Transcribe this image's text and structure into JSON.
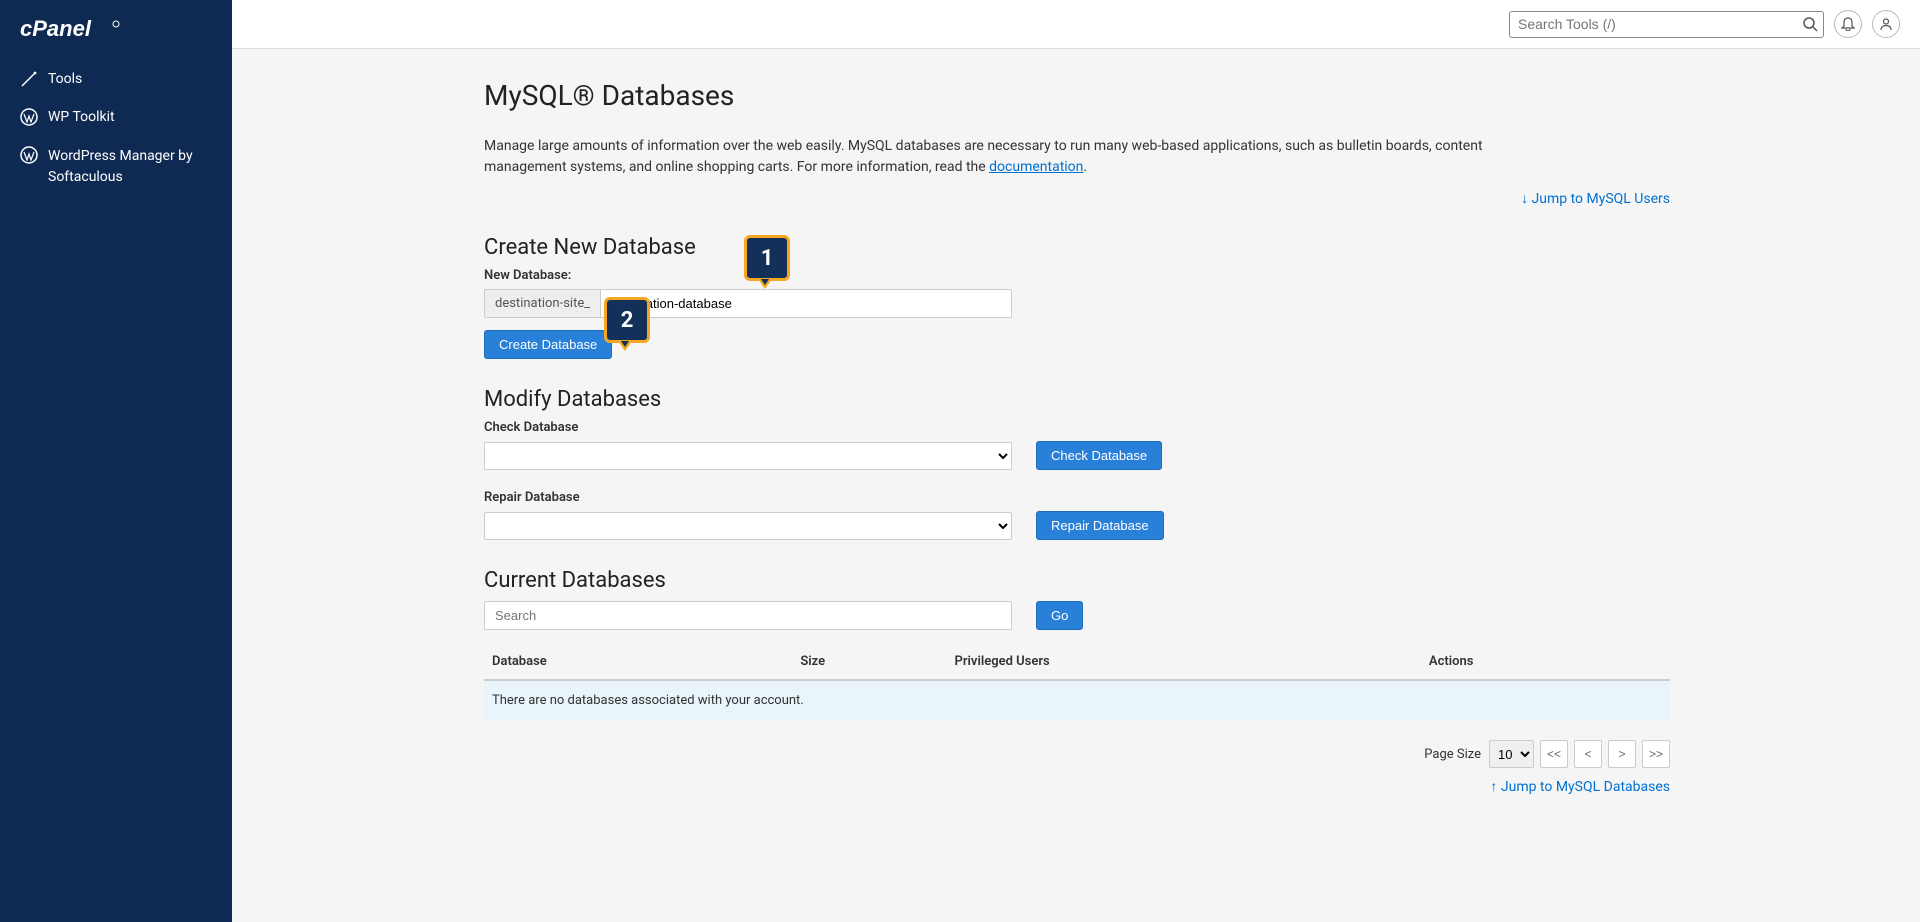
{
  "sidebar": {
    "items": [
      {
        "label": "Tools",
        "icon": "tools-icon"
      },
      {
        "label": "WP Toolkit",
        "icon": "wordpress-icon"
      },
      {
        "label": "WordPress Manager by Softaculous",
        "icon": "wordpress-icon"
      }
    ]
  },
  "topbar": {
    "search_placeholder": "Search Tools (/)"
  },
  "page": {
    "title": "MySQL® Databases",
    "intro_text": "Manage large amounts of information over the web easily. MySQL databases are necessary to run many web-based applications, such as bulletin boards, content management systems, and online shopping carts. For more information, read the ",
    "doc_link": "documentation",
    "intro_suffix": ".",
    "jump_users": "↓ Jump to MySQL Users",
    "jump_databases": "↑ Jump to MySQL Databases"
  },
  "create": {
    "heading": "Create New Database",
    "label": "New Database:",
    "prefix": "destination-site_",
    "value": "destination-database",
    "button": "Create Database"
  },
  "modify": {
    "heading": "Modify Databases",
    "check_label": "Check Database",
    "check_button": "Check Database",
    "repair_label": "Repair Database",
    "repair_button": "Repair Database"
  },
  "current": {
    "heading": "Current Databases",
    "search_placeholder": "Search",
    "go": "Go",
    "cols": {
      "db": "Database",
      "size": "Size",
      "users": "Privileged Users",
      "actions": "Actions"
    },
    "empty": "There are no databases associated with your account."
  },
  "pager": {
    "label": "Page Size",
    "size": "10",
    "first": "<<",
    "prev": "<",
    "next": ">",
    "last": ">>"
  },
  "callouts": {
    "1": "1",
    "2": "2"
  }
}
